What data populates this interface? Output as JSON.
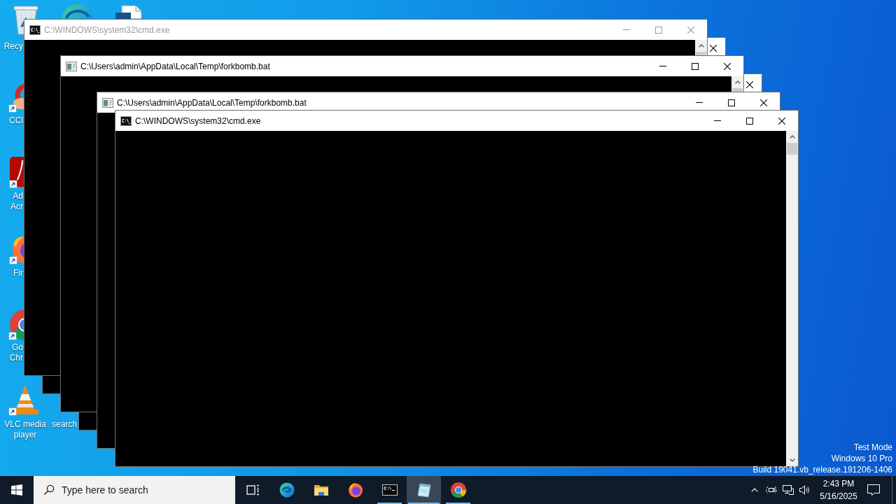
{
  "desktop_icons": [
    {
      "kind": "recycle-bin",
      "label": [
        "Recy"
      ]
    },
    {
      "kind": "edge"
    },
    {
      "kind": "document"
    },
    {
      "kind": "ccleaner",
      "shortcut": true,
      "label": [
        "CCl"
      ]
    },
    {
      "kind": "acrobat",
      "shortcut": true,
      "label": [
        "Ad",
        "Acr"
      ]
    },
    {
      "kind": "firefox",
      "shortcut": true,
      "label": [
        "Fir"
      ]
    },
    {
      "kind": "chrome",
      "shortcut": true,
      "label": [
        "Go",
        "Chr"
      ]
    },
    {
      "kind": "vlc",
      "shortcut": true,
      "label": [
        "VLC media",
        "player"
      ]
    },
    {
      "label": [
        "search"
      ]
    }
  ],
  "windows": [
    {
      "title": "C:\\WINDOWS\\system32\\cmd.exe",
      "kind": "console",
      "dimmed": true,
      "controls": [
        {
          "kind": "minimize"
        },
        {
          "kind": "maximize"
        },
        {
          "kind": "close"
        }
      ]
    },
    {
      "dimmed": false,
      "controls": [
        {
          "kind": "close"
        }
      ]
    },
    {
      "title": "C:\\Users\\admin\\AppData\\Local\\Temp\\forkbomb.bat",
      "kind": "batch",
      "dimmed": false,
      "controls": [
        {
          "kind": "minimize"
        },
        {
          "kind": "maximize"
        },
        {
          "kind": "close"
        }
      ]
    },
    {
      "dimmed": false,
      "controls": [
        {
          "kind": "close"
        }
      ]
    },
    {
      "title": "C:\\Users\\admin\\AppData\\Local\\Temp\\forkbomb.bat",
      "kind": "batch",
      "dimmed": false,
      "controls": [
        {
          "kind": "minimize"
        },
        {
          "kind": "maximize"
        },
        {
          "kind": "close"
        }
      ]
    },
    {
      "title": "C:\\WINDOWS\\system32\\cmd.exe",
      "kind": "console",
      "dimmed": false,
      "controls": [
        {
          "kind": "minimize"
        },
        {
          "kind": "maximize"
        },
        {
          "kind": "close"
        }
      ]
    }
  ],
  "system_notice": [
    "Test Mode",
    "Windows 10 Pro",
    "Build 19041.vb_release.191206-1406"
  ],
  "taskbar": {
    "search": {
      "placeholder": "Type here to search"
    },
    "apps": [
      {
        "kind": "task-view",
        "running": false,
        "selected": false
      },
      {
        "kind": "edge",
        "running": false,
        "selected": false
      },
      {
        "kind": "explorer",
        "running": false,
        "selected": false
      },
      {
        "kind": "firefox",
        "running": false,
        "selected": false
      },
      {
        "kind": "console",
        "running": true,
        "selected": false
      },
      {
        "kind": "notepad",
        "running": true,
        "selected": true
      },
      {
        "kind": "chrome",
        "running": true,
        "selected": false
      }
    ],
    "tray": {
      "time": "2:43 PM",
      "date": "5/16/2025"
    }
  }
}
